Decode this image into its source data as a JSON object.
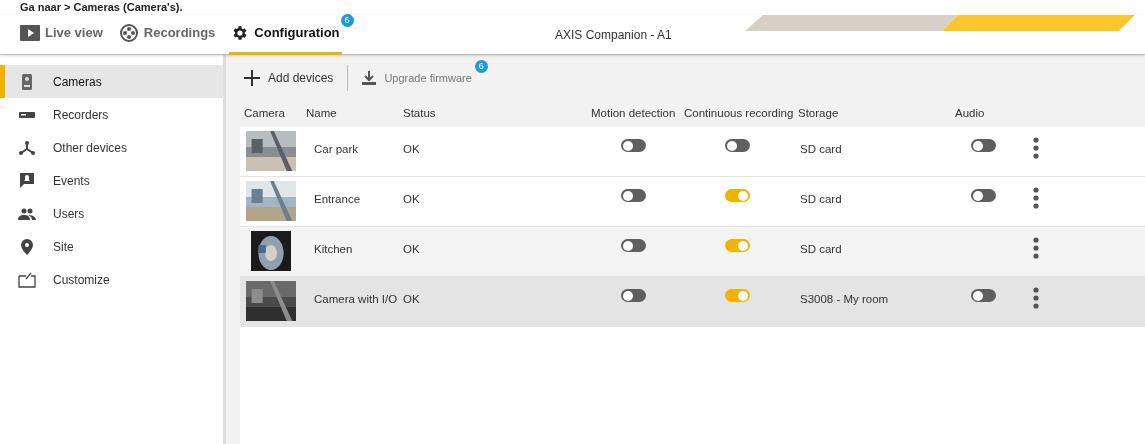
{
  "caption": "Ga naar > Cameras (Camera's).",
  "nav_tabs": [
    {
      "label": "Live view",
      "selected": false
    },
    {
      "label": "Recordings",
      "selected": false
    },
    {
      "label": "Configuration",
      "selected": true,
      "badge": "6"
    }
  ],
  "window": {
    "title": "AXIS Companion - A1"
  },
  "sidebar": {
    "items": [
      {
        "label": "Cameras",
        "selected": true
      },
      {
        "label": "Recorders",
        "selected": false
      },
      {
        "label": "Other devices",
        "selected": false
      },
      {
        "label": "Events",
        "selected": false
      },
      {
        "label": "Users",
        "selected": false
      },
      {
        "label": "Site",
        "selected": false
      },
      {
        "label": "Customize",
        "selected": false
      }
    ]
  },
  "toolbar": {
    "add": "Add devices",
    "upgrade": "Upgrade firmware",
    "upgrade_badge": "6"
  },
  "table": {
    "columns": [
      "Camera",
      "Name",
      "Status",
      "Motion detection",
      "Continuous recording",
      "Storage",
      "Audio"
    ],
    "rows": [
      {
        "name": "Car park",
        "status": "OK",
        "motion": false,
        "continuous": false,
        "storage": "SD card",
        "audio": {
          "on": false
        },
        "selected": false
      },
      {
        "name": "Entrance",
        "status": "OK",
        "motion": false,
        "continuous": true,
        "storage": "SD card",
        "audio": {
          "on": false
        },
        "selected": false
      },
      {
        "name": "Kitchen",
        "status": "OK",
        "motion": false,
        "continuous": true,
        "storage": "SD card",
        "selected": false,
        "hovered": true
      },
      {
        "name": "Camera with I/O",
        "status": "OK",
        "motion": false,
        "continuous": true,
        "storage": "S3008 - My room",
        "audio": {
          "on": false
        },
        "selected": true
      }
    ]
  }
}
